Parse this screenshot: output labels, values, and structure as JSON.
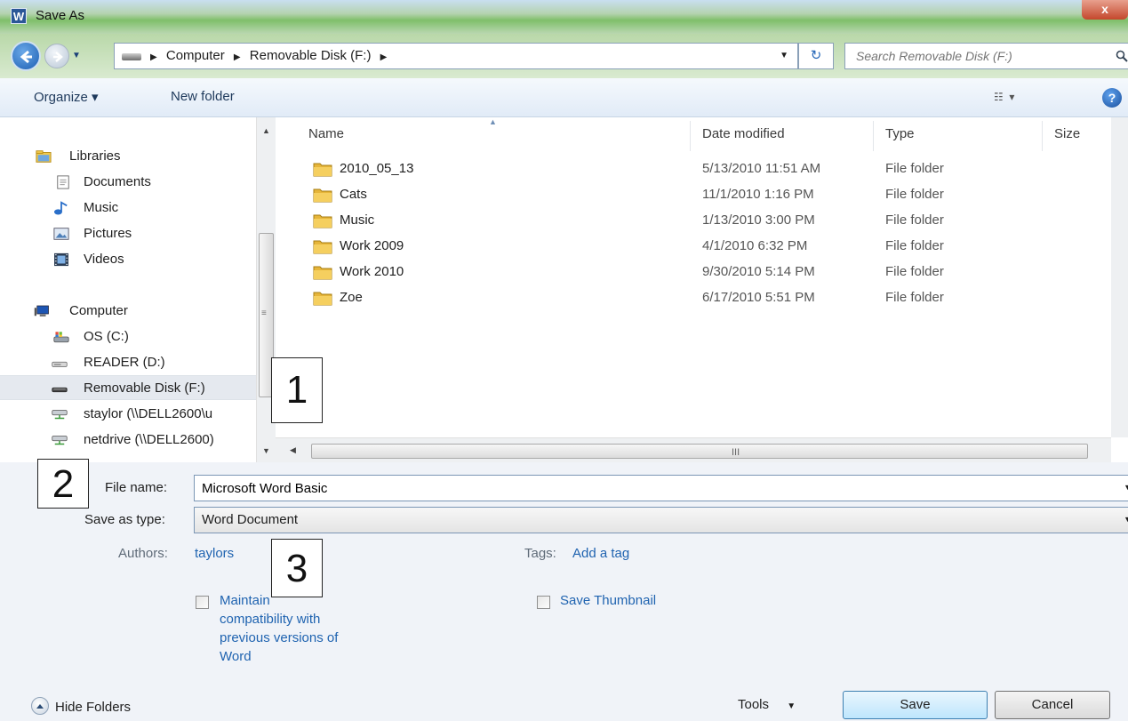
{
  "window": {
    "title": "Save As",
    "close_label": "x",
    "app_logo": "W"
  },
  "address": {
    "crumbs": [
      "Computer",
      "Removable Disk (F:)"
    ],
    "search_placeholder": "Search Removable Disk (F:)"
  },
  "toolbar": {
    "organize": "Organize ▾",
    "new_folder": "New folder",
    "help": "?"
  },
  "nav": {
    "items": [
      {
        "label": "Libraries",
        "icon": "libraries-icon"
      },
      {
        "label": "Documents",
        "icon": "documents-icon"
      },
      {
        "label": "Music",
        "icon": "music-icon"
      },
      {
        "label": "Pictures",
        "icon": "pictures-icon"
      },
      {
        "label": "Videos",
        "icon": "videos-icon"
      },
      {
        "label": "Computer",
        "icon": "computer-icon"
      },
      {
        "label": "OS (C:)",
        "icon": "os-drive-icon"
      },
      {
        "label": "READER (D:)",
        "icon": "reader-drive-icon"
      },
      {
        "label": "Removable Disk (F:)",
        "icon": "removable-disk-icon"
      },
      {
        "label": "staylor (\\\\DELL2600\\u",
        "icon": "network-drive-icon"
      },
      {
        "label": "netdrive (\\\\DELL2600)",
        "icon": "network-drive-icon"
      }
    ]
  },
  "columns": {
    "name": "Name",
    "date": "Date modified",
    "type": "Type",
    "size": "Size"
  },
  "files": [
    {
      "name": "2010_05_13",
      "date": "5/13/2010 11:51 AM",
      "type": "File folder"
    },
    {
      "name": "Cats",
      "date": "11/1/2010 1:16 PM",
      "type": "File folder"
    },
    {
      "name": "Music",
      "date": "1/13/2010 3:00 PM",
      "type": "File folder"
    },
    {
      "name": "Work 2009",
      "date": "4/1/2010 6:32 PM",
      "type": "File folder"
    },
    {
      "name": "Work 2010",
      "date": "9/30/2010 5:14 PM",
      "type": "File folder"
    },
    {
      "name": "Zoe",
      "date": "6/17/2010 5:51 PM",
      "type": "File folder"
    }
  ],
  "form": {
    "file_name_label": "File name:",
    "file_name_value": "Microsoft Word Basic",
    "save_type_label": "Save as type:",
    "save_type_value": "Word Document",
    "authors_label": "Authors:",
    "authors_value": "taylors",
    "tags_label": "Tags:",
    "tags_value": "Add a tag",
    "maintain_compat_lines": [
      "Maintain",
      "compatibility with",
      "previous versions of",
      "Word"
    ],
    "save_thumbnail": "Save Thumbnail"
  },
  "footer": {
    "hide_folders": "Hide Folders",
    "tools": "Tools",
    "save": "Save",
    "cancel": "Cancel"
  },
  "callouts": [
    "1",
    "2",
    "3"
  ]
}
